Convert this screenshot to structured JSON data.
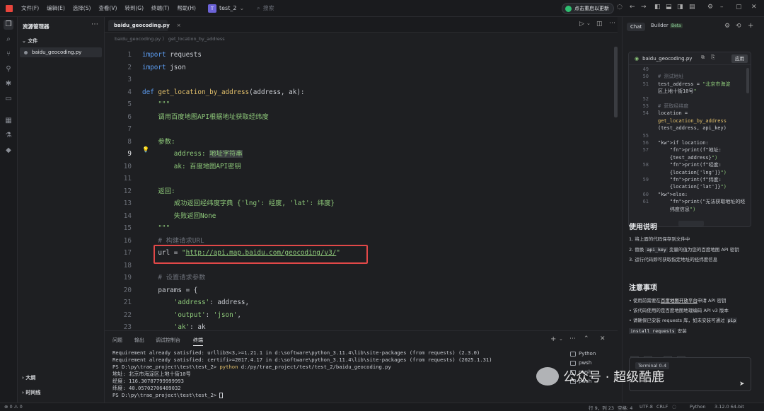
{
  "menu": [
    "文件(F)",
    "编辑(E)",
    "选择(S)",
    "查看(V)",
    "转到(G)",
    "终端(T)",
    "帮助(H)"
  ],
  "project": {
    "badge": "T",
    "name": "test_2"
  },
  "search_placeholder": "搜索",
  "update_label": "点击重启以更新",
  "explorer": {
    "title": "资源管理器",
    "folder": "文件",
    "file": "baidu_geocoding.py",
    "outline": "大纲",
    "timeline": "时间线"
  },
  "editor": {
    "tab": "baidu_geocoding.py",
    "breadcrumb": "baidu_geocoding.py  〉 get_location_by_address",
    "lines": [
      {
        "n": "1",
        "html": "<span class=\"kw\">import</span> requests"
      },
      {
        "n": "2",
        "html": "<span class=\"kw\">import</span> json"
      },
      {
        "n": "3",
        "html": ""
      },
      {
        "n": "4",
        "html": "<span class=\"kw\">def</span> <span class=\"fn\">get_location_by_address</span>(address, ak):"
      },
      {
        "n": "5",
        "html": "    <span class=\"st\">\"\"\"</span>"
      },
      {
        "n": "6",
        "html": "    <span class=\"st\">调用百度地图API根据地址获取经纬度</span>"
      },
      {
        "n": "7",
        "html": ""
      },
      {
        "n": "8",
        "html": "    <span class=\"st\">参数:</span>"
      },
      {
        "n": "9",
        "html": "        <span class=\"st\">address: <span class=\"hlword\">地址字符串</span></span>"
      },
      {
        "n": "10",
        "html": "        <span class=\"st\">ak: 百度地图API密钥</span>"
      },
      {
        "n": "11",
        "html": ""
      },
      {
        "n": "12",
        "html": "    <span class=\"st\">返回:</span>"
      },
      {
        "n": "13",
        "html": "        <span class=\"st\">成功返回经纬度字典 {'lng': 经度, 'lat': 纬度}</span>"
      },
      {
        "n": "14",
        "html": "        <span class=\"st\">失败返回None</span>"
      },
      {
        "n": "15",
        "html": "    <span class=\"st\">\"\"\"</span>"
      },
      {
        "n": "16",
        "html": "    <span class=\"cm\"># 构建请求URL</span>"
      },
      {
        "n": "17",
        "html": "    url = <span class=\"st\">\"<u>http://api.map.baidu.com/geocoding/v3/</u>\"</span>"
      },
      {
        "n": "18",
        "html": ""
      },
      {
        "n": "19",
        "html": "    <span class=\"cm\"># 设置请求参数</span>"
      },
      {
        "n": "20",
        "html": "    params = {"
      },
      {
        "n": "21",
        "html": "        <span class=\"st\">'address'</span>: address,"
      },
      {
        "n": "22",
        "html": "        <span class=\"st\">'output'</span>: <span class=\"st\">'json'</span>,"
      },
      {
        "n": "23",
        "html": "        <span class=\"st\">'ak'</span>: ak"
      }
    ]
  },
  "terminal": {
    "tabs": [
      "问题",
      "输出",
      "调试控制台",
      "终端"
    ],
    "lines": [
      "Requirement already satisfied: urllib3<3,>=1.21.1 in d:\\software\\python_3.11.4\\lib\\site-packages (from requests) (2.3.0)",
      "Requirement already satisfied: certifi>=2017.4.17 in d:\\software\\python_3.11.4\\lib\\site-packages (from requests) (2025.1.31)",
      "PS D:\\py\\trae_project\\test\\test_2> python d:/py/trae_project/test/test_2/baidu_geocoding.py",
      "地址: 北京市海淀区上地十街10号",
      "经度: 116.30787799999993",
      "纬度: 40.05702706489032",
      "PS D:\\py\\trae_project\\test\\test_2> "
    ],
    "sessions": [
      "Python",
      "pwsh",
      "pwsh",
      "pwsh"
    ]
  },
  "chat": {
    "tabs": [
      "Chat",
      "Builder"
    ],
    "beta": "Beta",
    "file": "baidu_geocoding.py",
    "apply": "应用",
    "snippet": [
      {
        "n": "49",
        "c": ""
      },
      {
        "n": "50",
        "c": "# 测试地址"
      },
      {
        "n": "51",
        "c": "test_address = \"北京市海淀"
      },
      {
        "n": "",
        "c": "区上地十街10号\""
      },
      {
        "n": "52",
        "c": ""
      },
      {
        "n": "53",
        "c": "# 获取经纬度"
      },
      {
        "n": "54",
        "c": "location ="
      },
      {
        "n": "",
        "c": "get_location_by_address"
      },
      {
        "n": "",
        "c": "(test_address, api_key)"
      },
      {
        "n": "55",
        "c": ""
      },
      {
        "n": "56",
        "c": "if location:"
      },
      {
        "n": "57",
        "c": "    print(f\"地址:"
      },
      {
        "n": "",
        "c": "    {test_address}\")"
      },
      {
        "n": "58",
        "c": "    print(f\"经度:"
      },
      {
        "n": "",
        "c": "    {location['lng']}\")"
      },
      {
        "n": "59",
        "c": "    print(f\"纬度:"
      },
      {
        "n": "",
        "c": "    {location['lat']}\")"
      },
      {
        "n": "60",
        "c": "else:"
      },
      {
        "n": "61",
        "c": "    print(\"无法获取地址的经"
      },
      {
        "n": "",
        "c": "    纬度信息\")"
      }
    ],
    "usage_title": "使用说明",
    "usage": [
      "1. 将上面的代码保存到文件中",
      "2. 替换 <code>api_key</code> 变量的值为您的百度地图 API 密钥",
      "3. 运行代码即可获取指定地址的经纬度信息"
    ],
    "notes_title": "注意事项",
    "notes": [
      "• 使用前需要在<u>百度地图开放平台</u>申请 API 密钥",
      "• 该代码使用的是百度地图地理编码 API v3 版本",
      "• 请确保已安装 requests 库，如未安装可通过 <code>pip</code>",
      "  <code>install requests</code> 安装"
    ],
    "terminal_card": "Terminal 0-4"
  },
  "watermark": "公众号 · 超级酷鹿",
  "status": {
    "left": "⊗ 0  ⚠ 0",
    "pos": "行 9，列 23",
    "spaces": "空格: 4",
    "enc": "UTF-8",
    "eol": "CRLF",
    "lang": "Python",
    "ver": "3.12.0 64-bit"
  }
}
